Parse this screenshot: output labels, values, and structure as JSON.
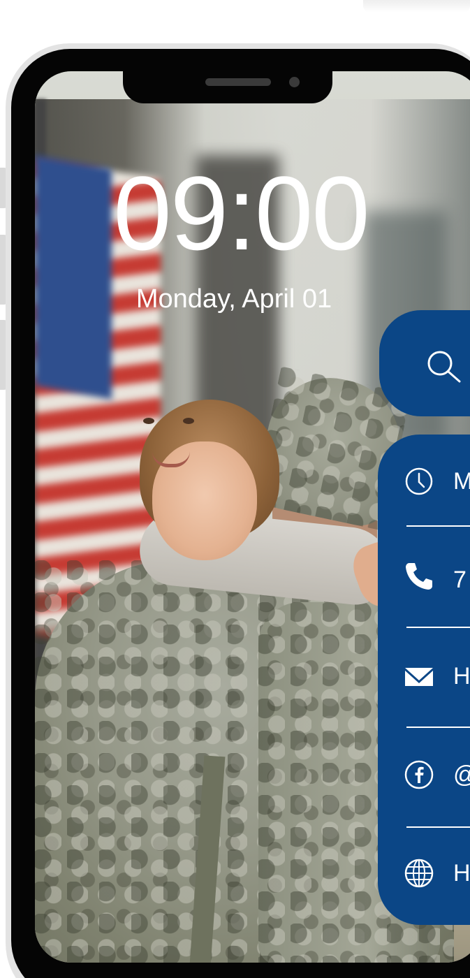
{
  "lock_screen": {
    "time": "09:00",
    "date": "Monday, April 01"
  },
  "search": {
    "icon": "search-icon"
  },
  "contact_panel": {
    "accent_color": "#0b4686",
    "rows": [
      {
        "icon": "clock-icon",
        "text": "M"
      },
      {
        "icon": "phone-icon",
        "text": "7"
      },
      {
        "icon": "mail-icon",
        "text": "H"
      },
      {
        "icon": "facebook-icon",
        "text": "@"
      },
      {
        "icon": "globe-icon",
        "text": "H"
      }
    ]
  }
}
